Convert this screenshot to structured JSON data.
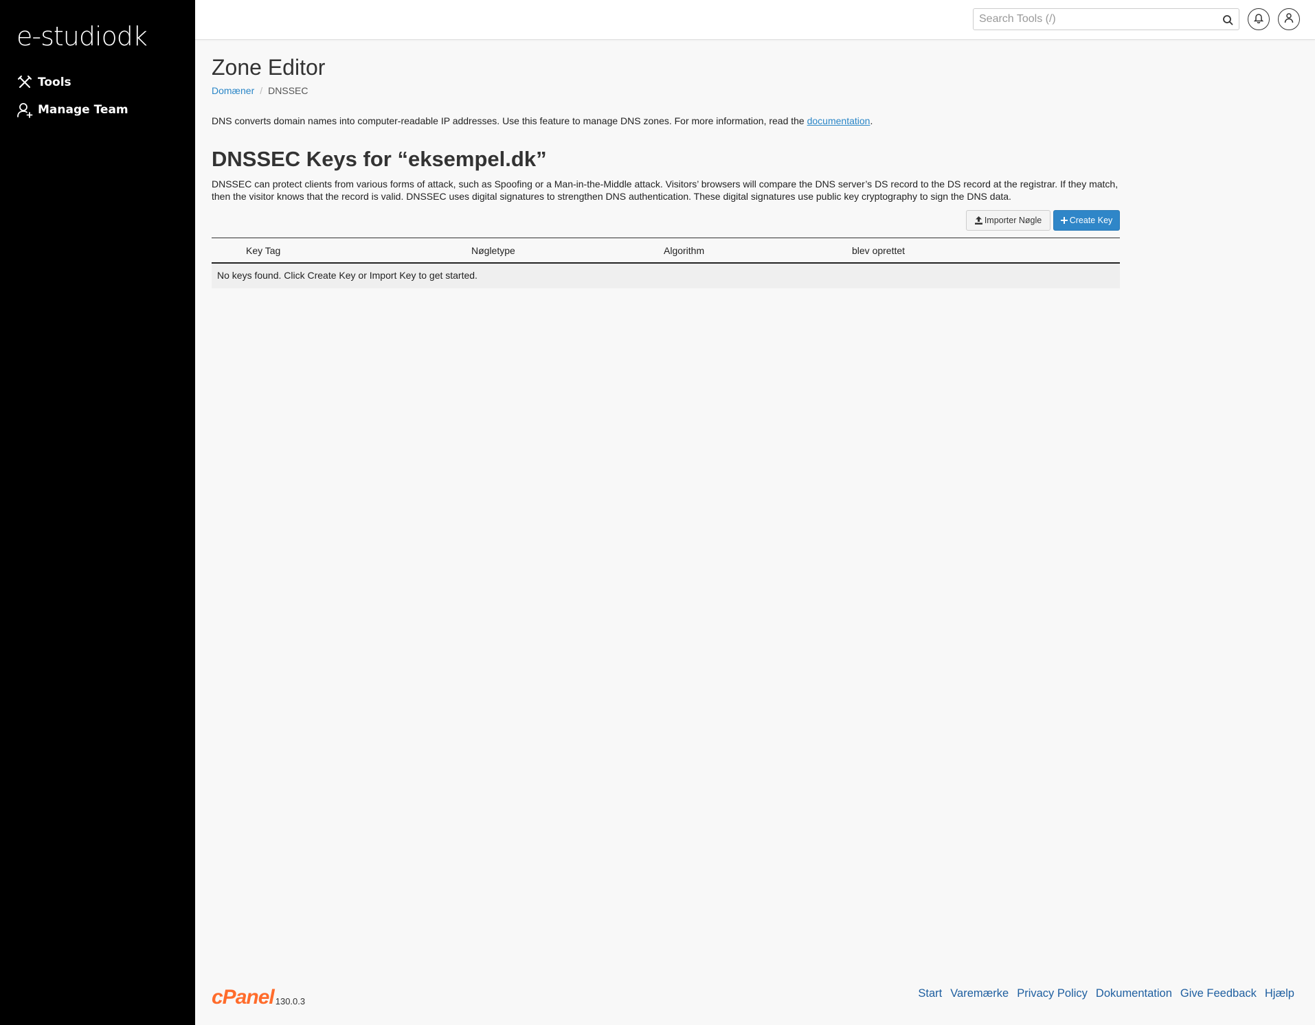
{
  "brand": {
    "logo_text": "e-studiodk",
    "accent_color": "#2f86c8",
    "link_color": "#2a86c7",
    "sidebar_bg": "#000000",
    "cpanel_color": "#ff6c2c"
  },
  "sidebar": {
    "items": [
      {
        "label": "Tools",
        "icon": "tools-icon"
      },
      {
        "label": "Manage Team",
        "icon": "team-icon"
      }
    ]
  },
  "header": {
    "search_placeholder": "Search Tools (/)",
    "search_icon": "search-icon",
    "notifications_icon": "bell-icon",
    "user_icon": "user-icon"
  },
  "page": {
    "title": "Zone Editor",
    "breadcrumb": [
      {
        "label": "Domæner",
        "link": true
      },
      {
        "label": "DNSSEC",
        "link": false
      }
    ],
    "intro_text": "DNS converts domain names into computer-readable IP addresses. Use this feature to manage DNS zones. For more information, read the ",
    "intro_link": "documentation",
    "intro_end": ".",
    "section_title": "DNSSEC Keys for “eksempel.dk”",
    "description": "DNSSEC can protect clients from various forms of attack, such as Spoofing or a Man-in-the-Middle attack. Visitors’ browsers will compare the DNS server’s DS record to the DS record at the registrar. If they match, then the visitor knows that the record is valid. DNSSEC uses digital signatures to strengthen DNS authentication. These digital signatures use public key cryptography to sign the DNS data."
  },
  "actions": {
    "import_label": "Importer Nøgle",
    "create_label": "Create Key"
  },
  "table": {
    "columns": [
      "Key Tag",
      "Nøgletype",
      "Algorithm",
      "blev oprettet"
    ],
    "empty_message": "No keys found. Click Create Key or Import Key to get started."
  },
  "footer": {
    "cpanel_logo": "cPanel",
    "version": "130.0.3",
    "links": [
      "Start",
      "Varemærke",
      "Privacy Policy",
      "Dokumentation",
      "Give Feedback",
      "Hjælp"
    ]
  }
}
